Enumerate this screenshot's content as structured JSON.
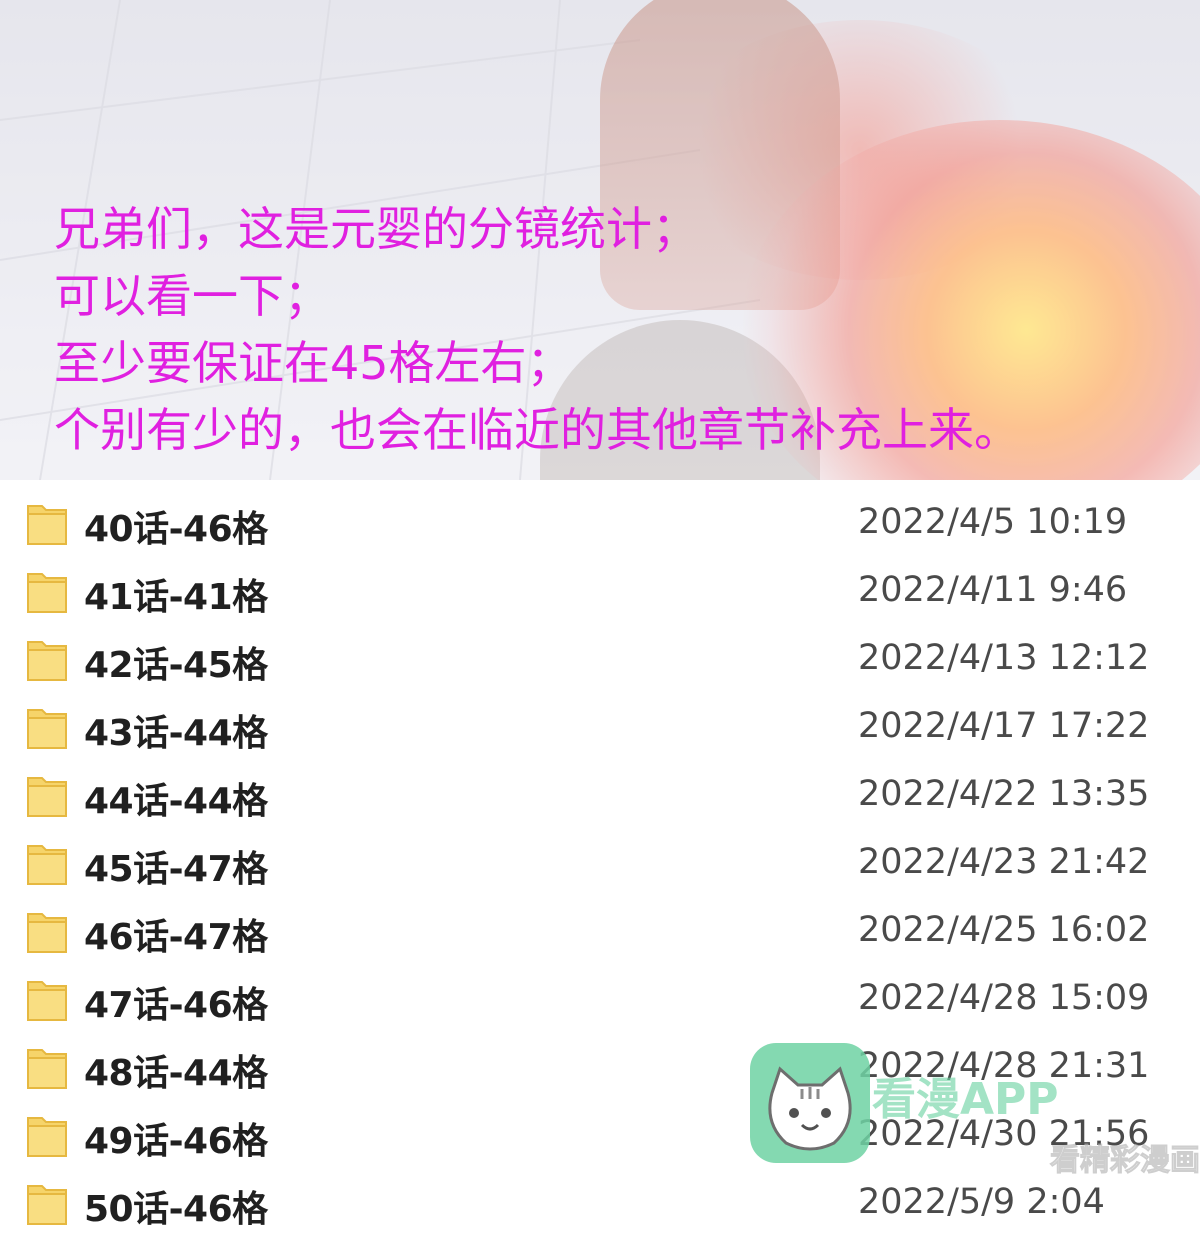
{
  "notice": {
    "lines": [
      "兄弟们，这是元婴的分镜统计；",
      "可以看一下；",
      "至少要保证在45格左右；",
      "个别有少的，也会在临近的其他章节补充上来。"
    ],
    "color": "#e020e0"
  },
  "files": [
    {
      "name": "40话-46格",
      "date": "2022/4/5 10:19"
    },
    {
      "name": "41话-41格",
      "date": "2022/4/11 9:46"
    },
    {
      "name": "42话-45格",
      "date": "2022/4/13 12:12"
    },
    {
      "name": "43话-44格",
      "date": "2022/4/17 17:22"
    },
    {
      "name": "44话-44格",
      "date": "2022/4/22 13:35"
    },
    {
      "name": "45话-47格",
      "date": "2022/4/23 21:42"
    },
    {
      "name": "46话-47格",
      "date": "2022/4/25 16:02"
    },
    {
      "name": "47话-46格",
      "date": "2022/4/28 15:09"
    },
    {
      "name": "48话-44格",
      "date": "2022/4/28 21:31"
    },
    {
      "name": "49话-46格",
      "date": "2022/4/30 21:56"
    },
    {
      "name": "50话-46格",
      "date": "2022/5/9 2:04"
    }
  ],
  "icons": {
    "folder": "folder-icon",
    "watermark_logo": "cat-logo-icon"
  },
  "colors": {
    "folder": "#f6d46a",
    "folder_edge": "#e6b840",
    "watermark": "#6fd3a4"
  },
  "watermark": {
    "text": "看漫APP",
    "subtext": "看精彩漫画"
  }
}
